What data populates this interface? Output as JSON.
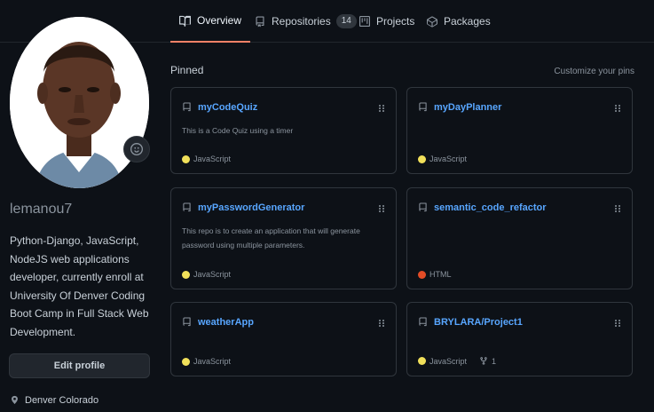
{
  "tabs": [
    {
      "label": "Overview",
      "icon": "book-icon",
      "active": true
    },
    {
      "label": "Repositories",
      "icon": "repo-icon",
      "count": "14"
    },
    {
      "label": "Projects",
      "icon": "project-icon"
    },
    {
      "label": "Packages",
      "icon": "package-icon"
    }
  ],
  "profile": {
    "username": "lemanou7",
    "bio": "Python-Django, JavaScript, NodeJS web applications developer, currently enroll at University Of Denver Coding Boot Camp in Full Stack Web Development.",
    "edit_label": "Edit profile",
    "location": "Denver Colorado"
  },
  "pinned": {
    "title": "Pinned",
    "customize_label": "Customize your pins",
    "repos": [
      {
        "name": "myCodeQuiz",
        "description": "This is a Code Quiz using a timer",
        "language": "JavaScript",
        "lang_color": "#f1e05a"
      },
      {
        "name": "myDayPlanner",
        "description": "",
        "language": "JavaScript",
        "lang_color": "#f1e05a"
      },
      {
        "name": "myPasswordGenerator",
        "description": "This repo is to create an application that will generate password using multiple parameters.",
        "language": "JavaScript",
        "lang_color": "#f1e05a"
      },
      {
        "name": "semantic_code_refactor",
        "description": "",
        "language": "HTML",
        "lang_color": "#e34c26"
      },
      {
        "name": "weatherApp",
        "description": "",
        "language": "JavaScript",
        "lang_color": "#f1e05a"
      },
      {
        "name": "BRYLARA/Project1",
        "description": "",
        "language": "JavaScript",
        "lang_color": "#f1e05a",
        "forks": "1"
      }
    ]
  },
  "colors": {
    "accent": "#f78166",
    "link": "#58a6ff",
    "background": "#0d1117"
  }
}
